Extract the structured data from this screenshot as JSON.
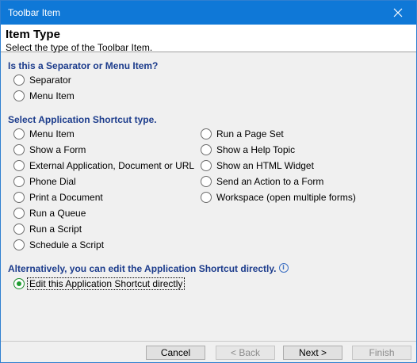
{
  "window": {
    "title": "Toolbar Item"
  },
  "header": {
    "title": "Item Type",
    "subtitle": "Select the type of the Toolbar Item."
  },
  "sections": {
    "separator_or_menu": {
      "title": "Is this a Separator or Menu Item?",
      "options": [
        "Separator",
        "Menu Item"
      ]
    },
    "shortcut_type": {
      "title": "Select Application Shortcut type.",
      "left_options": [
        "Menu Item",
        "Show a Form",
        "External Application, Document or URL",
        "Phone Dial",
        "Print a Document",
        "Run a Queue",
        "Run a Script",
        "Schedule a Script"
      ],
      "right_options": [
        "Run a Page Set",
        "Show a Help Topic",
        "Show an HTML Widget",
        "Send an Action to a Form",
        "Workspace (open multiple forms)"
      ]
    },
    "direct_edit": {
      "title": "Alternatively, you can edit the Application Shortcut directly.",
      "option": "Edit this Application Shortcut directly",
      "selected": true
    }
  },
  "footer": {
    "cancel": "Cancel",
    "back": "< Back",
    "next": "Next >",
    "finish": "Finish"
  }
}
